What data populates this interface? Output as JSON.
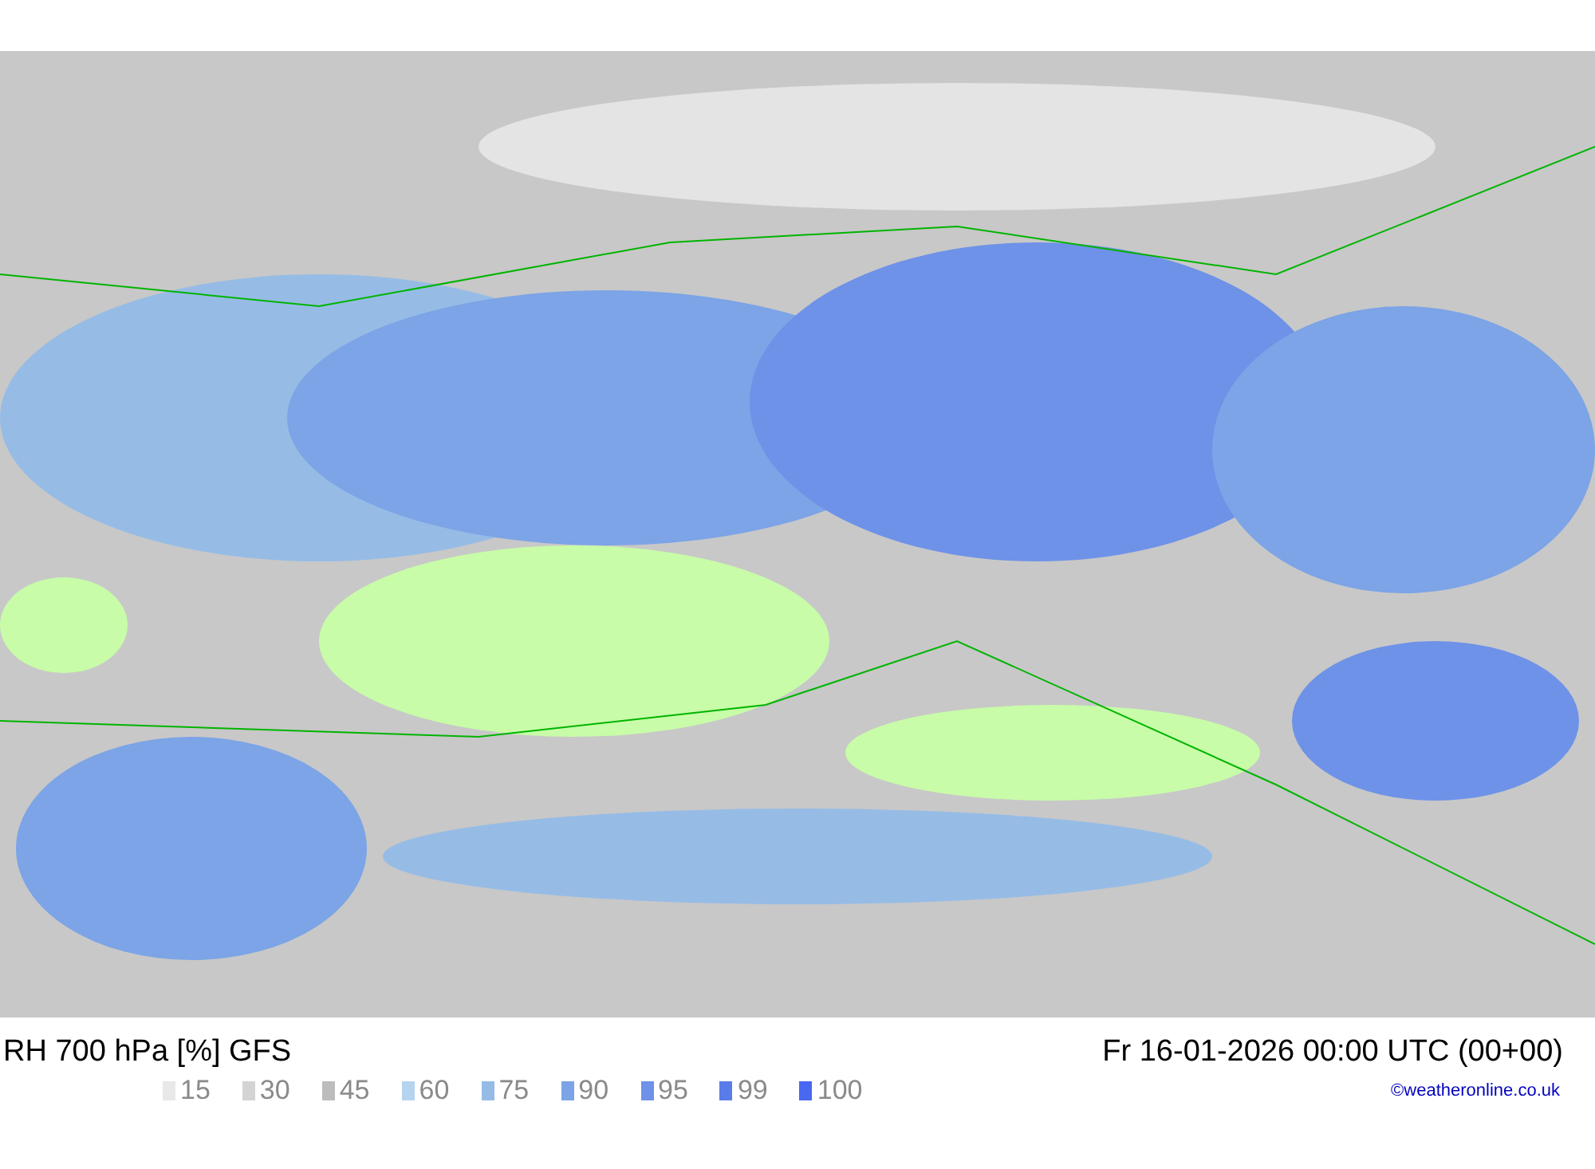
{
  "title": "RH 700 hPa [%] GFS",
  "valid_time": "Fr 16-01-2026 00:00 UTC (00+00)",
  "legend": [
    {
      "label": "15",
      "color": "#e8e8e8"
    },
    {
      "label": "30",
      "color": "#d4d4d4"
    },
    {
      "label": "45",
      "color": "#bcbcbc"
    },
    {
      "label": "60",
      "color": "#b4d4f0"
    },
    {
      "label": "75",
      "color": "#96bce6"
    },
    {
      "label": "90",
      "color": "#7ca4e6"
    },
    {
      "label": "95",
      "color": "#6e92e8"
    },
    {
      "label": "99",
      "color": "#5a7ce8"
    },
    {
      "label": "100",
      "color": "#4868f0"
    }
  ],
  "credit": "©weatheronline.co.uk"
}
